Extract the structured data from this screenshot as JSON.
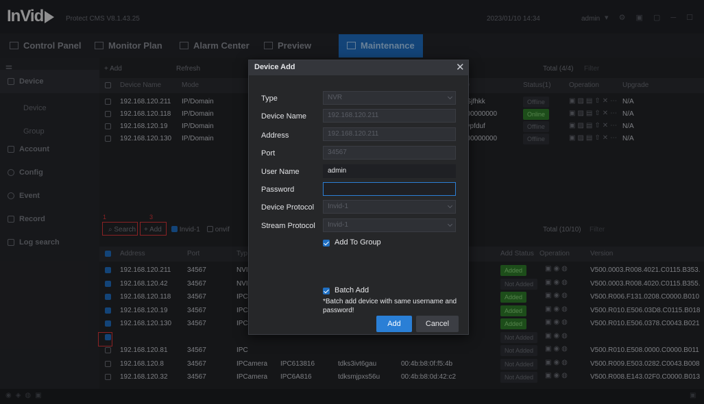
{
  "app": {
    "name": "InVid",
    "version": "Protect CMS V8.1.43.25",
    "datetime": "2023/01/10 14:34",
    "user": "admin"
  },
  "nav": [
    {
      "label": "Control Panel"
    },
    {
      "label": "Monitor Plan"
    },
    {
      "label": "Alarm Center"
    },
    {
      "label": "Preview"
    },
    {
      "label": "Maintenance"
    }
  ],
  "sidebar": {
    "device": "Device",
    "device_sub": "Device",
    "group_sub": "Group",
    "account": "Account",
    "config": "Config",
    "event": "Event",
    "record": "Record",
    "log_search": "Log search"
  },
  "top_toolbar": {
    "add": "+ Add",
    "refresh": "Refresh",
    "total": "Total (4/4)",
    "filter": "Filter"
  },
  "top_table": {
    "headers": {
      "name": "Device Name",
      "mode": "Mode",
      "id": "ID",
      "status": "Status(1)",
      "operation": "Operation",
      "upgrade": "Upgrade"
    },
    "rows": [
      {
        "name": "192.168.120.211",
        "mode": "IP/Domain",
        "id": "9Sjfhkk",
        "status": "Offline",
        "upgrade": "N/A"
      },
      {
        "name": "192.168.120.118",
        "mode": "IP/Domain",
        "id": "000000000",
        "status": "Online",
        "upgrade": "N/A"
      },
      {
        "name": "192.168.120.19",
        "mode": "IP/Domain",
        "id": "gypfduf",
        "status": "Offline",
        "upgrade": "N/A"
      },
      {
        "name": "192.168.120.130",
        "mode": "IP/Domain",
        "id": "000000000",
        "status": "Offline",
        "upgrade": "N/A"
      }
    ]
  },
  "bottom_toolbar": {
    "search": "Search",
    "add": "+ Add",
    "invid": "Invid-1",
    "onvif": "onvif",
    "total": "Total (10/10)",
    "filter": "Filter",
    "mark1": "1",
    "mark3": "3"
  },
  "bottom_table": {
    "headers": {
      "address": "Address",
      "port": "Port",
      "type": "Typ",
      "add_status": "Add Status",
      "operation": "Operation",
      "version": "Version"
    },
    "rows": [
      {
        "address": "192.168.120.211",
        "port": "34567",
        "type": "NVI",
        "model": "",
        "sn": "",
        "mac": "",
        "status": "Added",
        "version": "V500.0003.R008.4021.C0115.B353."
      },
      {
        "address": "192.168.120.42",
        "port": "34567",
        "type": "NVI",
        "model": "",
        "sn": "",
        "mac": "",
        "status": "Not Added",
        "version": "V500.0003.R008.4020.C0115.B355."
      },
      {
        "address": "192.168.120.118",
        "port": "34567",
        "type": "IPC",
        "model": "",
        "sn": "",
        "mac": "",
        "status": "Added",
        "version": "V500.R006.F131.0208.C0000.B010"
      },
      {
        "address": "192.168.120.19",
        "port": "34567",
        "type": "IPC",
        "model": "",
        "sn": "",
        "mac": "",
        "status": "Added",
        "version": "V500.R010.E506.03D8.C0115.B018"
      },
      {
        "address": "192.168.120.130",
        "port": "34567",
        "type": "IPC",
        "model": "",
        "sn": "",
        "mac": "",
        "status": "Added",
        "version": "V500.R010.E506.0378.C0043.B021"
      },
      {
        "address": "",
        "port": "",
        "type": "",
        "model": "",
        "sn": "",
        "mac": "",
        "status": "Not Added",
        "version": ""
      },
      {
        "address": "192.168.120.81",
        "port": "34567",
        "type": "IPC",
        "model": "",
        "sn": "",
        "mac": "",
        "status": "Not Added",
        "version": "V500.R010.E508.0000.C0000.B011"
      },
      {
        "address": "192.168.120.8",
        "port": "34567",
        "type": "IPCamera",
        "model": "IPC613816",
        "sn": "tdks3ivt6gau",
        "mac": "00:4b:b8:0f:f5:4b",
        "status": "Not Added",
        "version": "V500.R009.E503.0282.C0043.B008"
      },
      {
        "address": "192.168.120.32",
        "port": "34567",
        "type": "IPCamera",
        "model": "IPC6A816",
        "sn": "tdksmjpxs56u",
        "mac": "00:4b:b8:0d:42:c2",
        "status": "Not Added",
        "version": "V500.R008.E143.02F0.C0000.B013"
      }
    ]
  },
  "modal": {
    "title": "Device Add",
    "type_label": "Type",
    "type_value": "NVR",
    "device_name_label": "Device Name",
    "device_name_value": "192.168.120.211",
    "address_label": "Address",
    "address_value": "192.168.120.211",
    "port_label": "Port",
    "port_value": "34567",
    "username_label": "User Name",
    "username_value": "admin",
    "password_label": "Password",
    "password_value": "",
    "device_protocol_label": "Device Protocol",
    "device_protocol_value": "Invid-1",
    "stream_protocol_label": "Stream Protocol",
    "stream_protocol_value": "Invid-1",
    "add_to_group": "Add To Group",
    "batch_add": "Batch Add",
    "batch_note": "*Batch add device with same username and password!",
    "add_button": "Add",
    "cancel_button": "Cancel"
  },
  "colors": {
    "accent": "#1f6fc2",
    "added": "#2f7d2a",
    "marker": "#e0383a"
  }
}
